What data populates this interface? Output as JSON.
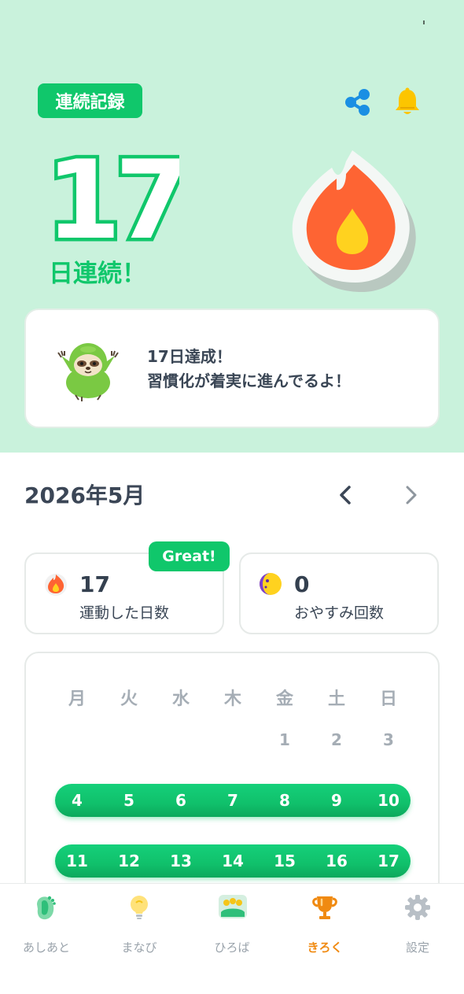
{
  "header": {
    "title": "連続記録",
    "streak_number": "17",
    "streak_label": "日連続！"
  },
  "message": {
    "line1": "17日達成！",
    "line2": "習慣化が着実に進んでるよ！"
  },
  "calendar_header": {
    "month": "2026年5月"
  },
  "stats": {
    "badge": "Great!",
    "exercise_days": "17",
    "exercise_label": "運動した日数",
    "rest_count": "0",
    "rest_label": "おやすみ回数"
  },
  "calendar": {
    "weekdays": [
      "月",
      "火",
      "水",
      "木",
      "金",
      "土",
      "日"
    ],
    "week1": [
      "",
      "",
      "",
      "",
      "1",
      "2",
      "3"
    ],
    "week2": [
      "4",
      "5",
      "6",
      "7",
      "8",
      "9",
      "10"
    ],
    "week3": [
      "11",
      "12",
      "13",
      "14",
      "15",
      "16",
      "17"
    ]
  },
  "tabs": [
    {
      "label": "あしあと",
      "icon": "footprint-icon"
    },
    {
      "label": "まなび",
      "icon": "lightbulb-icon"
    },
    {
      "label": "ひろば",
      "icon": "plaza-icon"
    },
    {
      "label": "きろく",
      "icon": "trophy-icon"
    },
    {
      "label": "設定",
      "icon": "gear-icon"
    }
  ],
  "active_tab": "きろく",
  "colors": {
    "accent": "#10c76b",
    "hero_bg": "#c9f2dc",
    "flame": "#fe6433",
    "active_tab": "#f08a11"
  }
}
